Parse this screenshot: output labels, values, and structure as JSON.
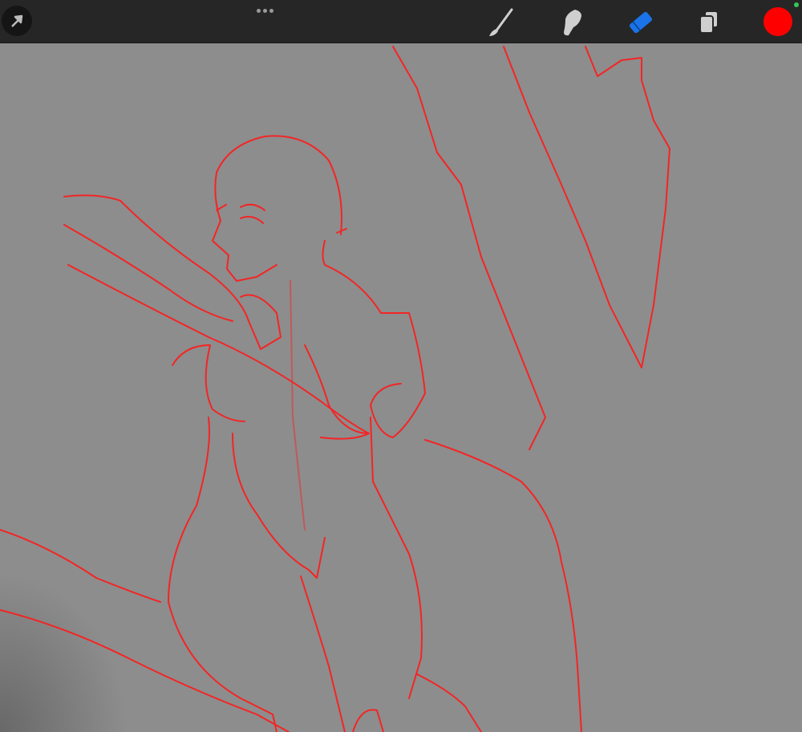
{
  "app": {
    "name": "drawing-canvas"
  },
  "toolbar": {
    "left": [
      {
        "icon": "transform-arrow-icon"
      }
    ],
    "center": {
      "icon": "more-dots-icon"
    },
    "tools": [
      {
        "icon": "brush-icon",
        "active": false
      },
      {
        "icon": "smudge-icon",
        "active": false
      },
      {
        "icon": "eraser-icon",
        "active": true
      },
      {
        "icon": "layers-icon",
        "active": false
      }
    ],
    "current_color": "#ff0000",
    "active_tool_color": "#1a73e8",
    "status_indicator_color": "#34c759"
  },
  "canvas": {
    "background": "#8d8d8d",
    "stroke_color": "#ff1a1a"
  }
}
